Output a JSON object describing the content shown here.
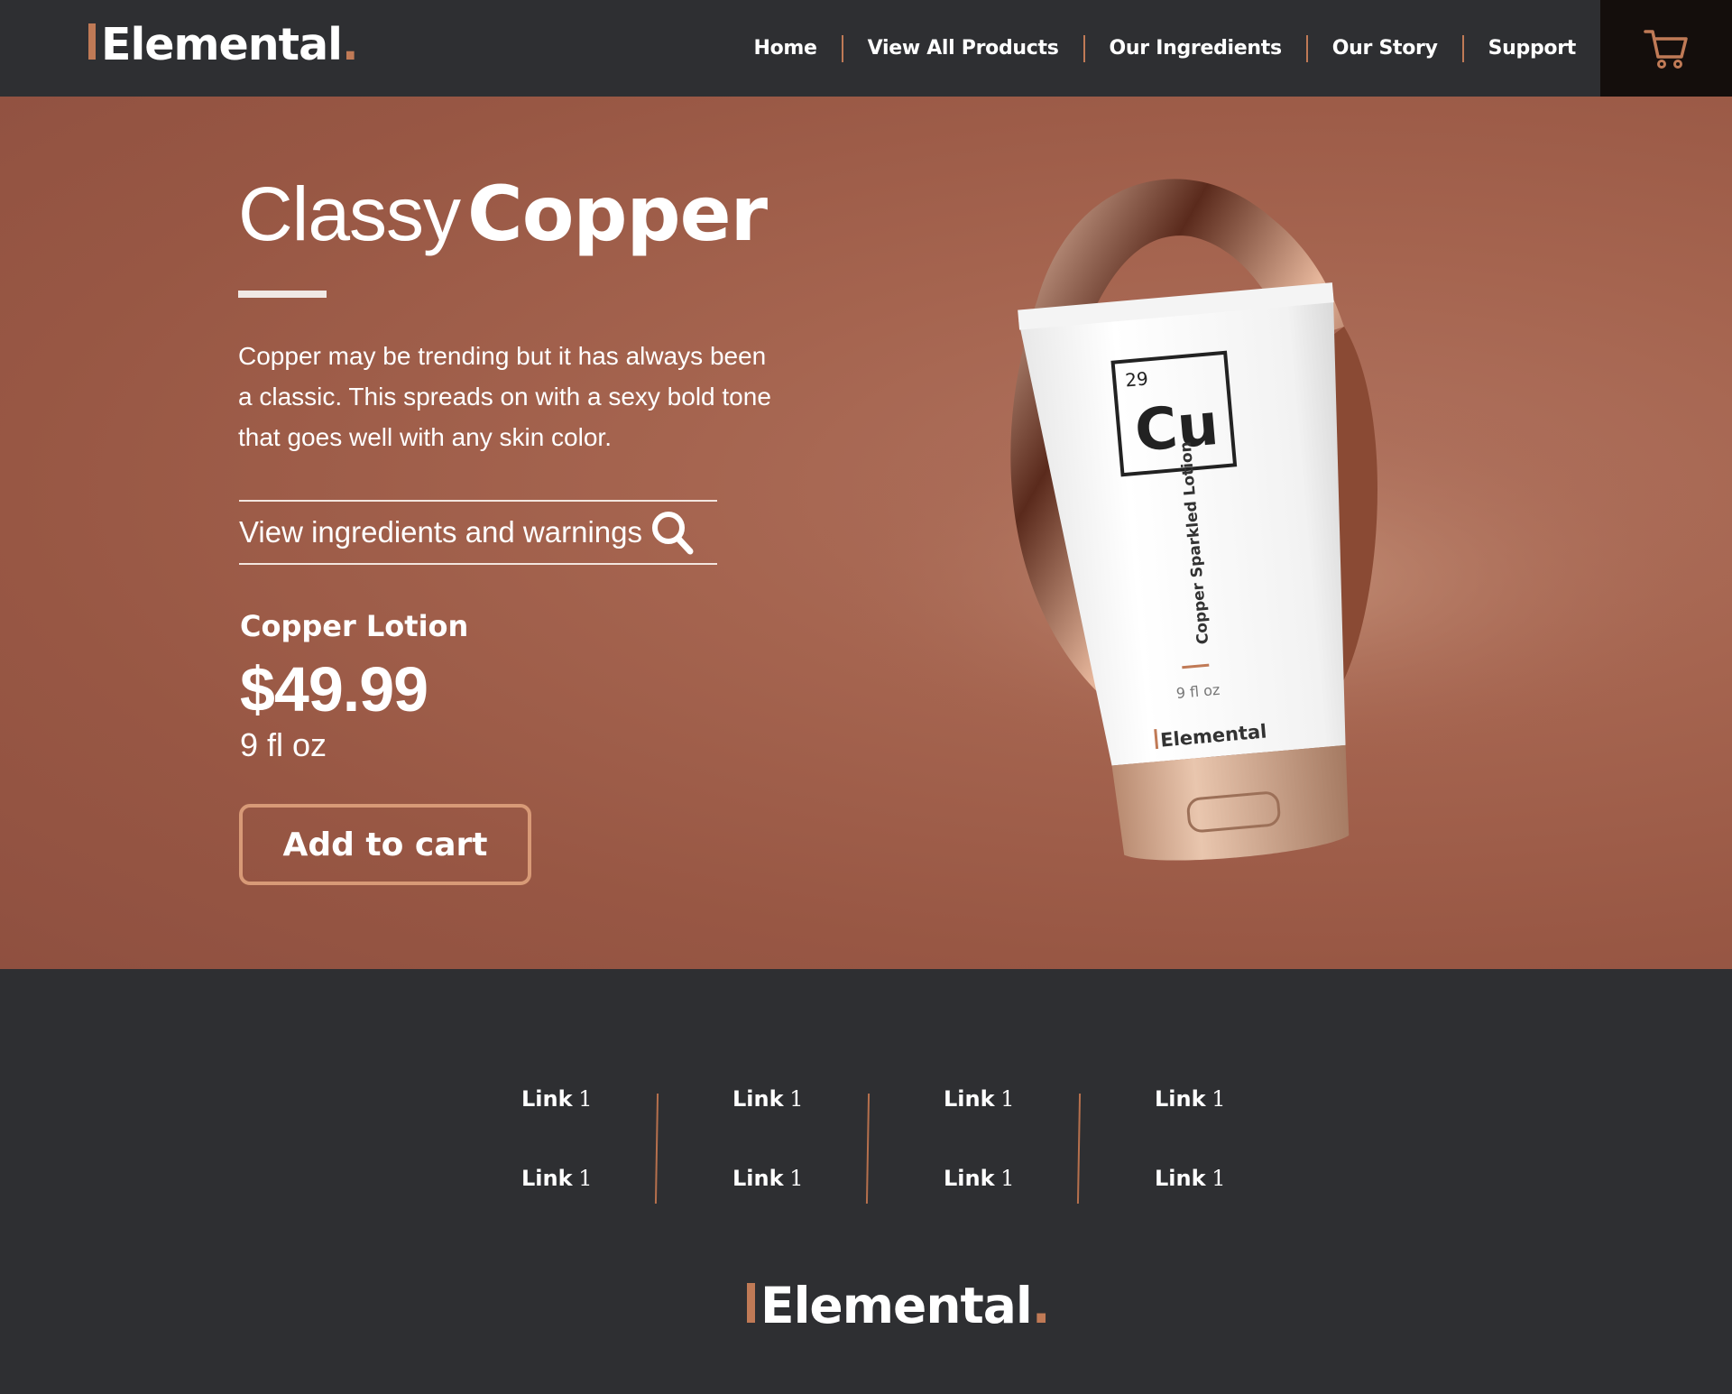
{
  "brand": {
    "name": "Elemental",
    "dot": "."
  },
  "nav": {
    "items": [
      "Home",
      "View All Products",
      "Our Ingredients",
      "Our Story",
      "Support"
    ]
  },
  "cart": {
    "icon": "shopping-cart-icon"
  },
  "hero": {
    "title_light": "Classy",
    "title_bold": "Copper",
    "description": "Copper may be trending but it has always been a classic. This spreads on with a sexy bold tone that goes well with any skin color.",
    "ingredients_link": "View ingredients and warnings",
    "product_name": "Copper Lotion",
    "price": "$49.99",
    "size": "9 fl oz",
    "add_to_cart": "Add to cart"
  },
  "product_image": {
    "element_number": "29",
    "element_symbol": "Cu",
    "product_label": "Copper Sparkled Lotion",
    "volume": "9 fl oz",
    "brand": "Elemental"
  },
  "footer": {
    "columns": [
      {
        "links": [
          {
            "word": "Link",
            "num": "1"
          },
          {
            "word": "Link",
            "num": "1"
          }
        ]
      },
      {
        "links": [
          {
            "word": "Link",
            "num": "1"
          },
          {
            "word": "Link",
            "num": "1"
          }
        ]
      },
      {
        "links": [
          {
            "word": "Link",
            "num": "1"
          },
          {
            "word": "Link",
            "num": "1"
          }
        ]
      },
      {
        "links": [
          {
            "word": "Link",
            "num": "1"
          },
          {
            "word": "Link",
            "num": "1"
          }
        ]
      }
    ]
  },
  "colors": {
    "accent": "#c07a56",
    "header_bg": "#2e2f32",
    "cart_bg": "#140e0c",
    "hero_bg": "#a5644f"
  }
}
